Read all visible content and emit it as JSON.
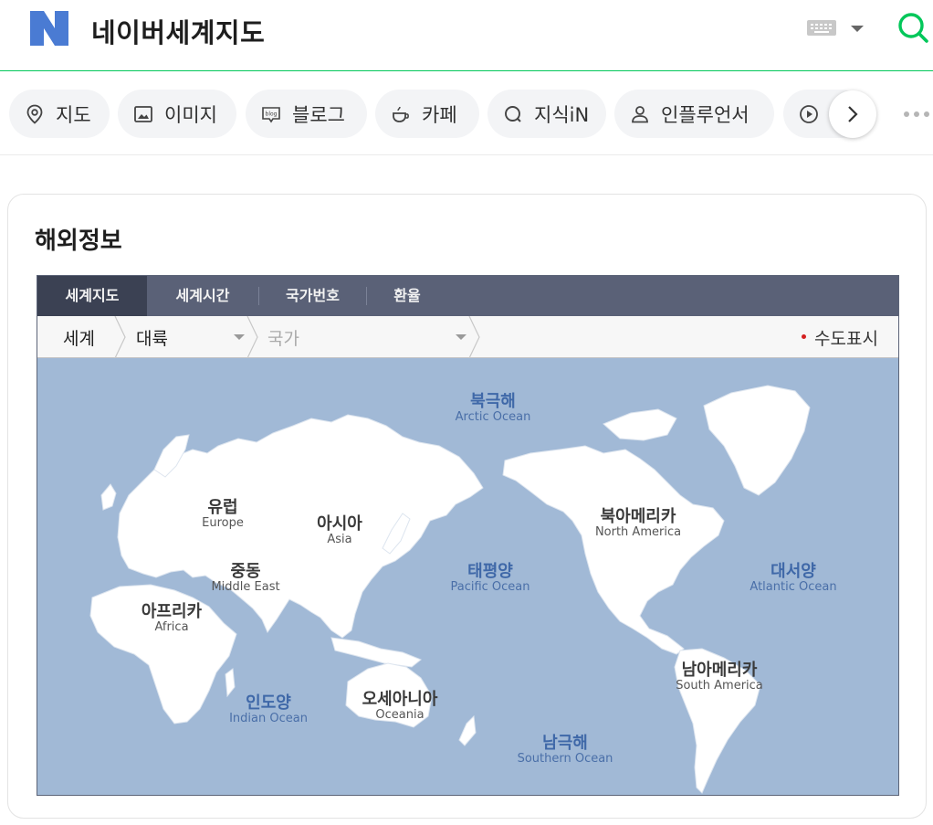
{
  "header": {
    "logo_letter": "N",
    "query": "네이버세계지도",
    "brand_color": "#03c75a"
  },
  "tabs": [
    {
      "label": "지도",
      "icon": "map-pin-icon"
    },
    {
      "label": "이미지",
      "icon": "image-icon"
    },
    {
      "label": "블로그",
      "icon": "blog-icon"
    },
    {
      "label": "카페",
      "icon": "cafe-cup-icon"
    },
    {
      "label": "지식iN",
      "icon": "knowledge-icon"
    },
    {
      "label": "인플루언서",
      "icon": "person-icon"
    },
    {
      "label": "",
      "icon": "play-icon"
    }
  ],
  "card": {
    "title": "해외정보",
    "widget_tabs": [
      "세계지도",
      "세계시간",
      "국가번호",
      "환율"
    ],
    "active_tab": "세계지도",
    "breadcrumb": {
      "root": "세계",
      "continent": "대륙",
      "country": "국가"
    },
    "capital_toggle": "수도표시",
    "capital_dot_color": "#d42020"
  },
  "map": {
    "ocean_color": "#a1b9d6",
    "regions": [
      {
        "ko": "유럽",
        "en": "Europe"
      },
      {
        "ko": "아시아",
        "en": "Asia"
      },
      {
        "ko": "중동",
        "en": "Middle East"
      },
      {
        "ko": "아프리카",
        "en": "Africa"
      },
      {
        "ko": "오세아니아",
        "en": "Oceania"
      },
      {
        "ko": "북아메리카",
        "en": "North America"
      },
      {
        "ko": "남아메리카",
        "en": "South America"
      }
    ],
    "oceans": [
      {
        "ko": "북극해",
        "en": "Arctic Ocean"
      },
      {
        "ko": "태평양",
        "en": "Pacific Ocean"
      },
      {
        "ko": "대서양",
        "en": "Atlantic Ocean"
      },
      {
        "ko": "인도양",
        "en": "Indian Ocean"
      },
      {
        "ko": "남극해",
        "en": "Southern Ocean"
      }
    ]
  }
}
